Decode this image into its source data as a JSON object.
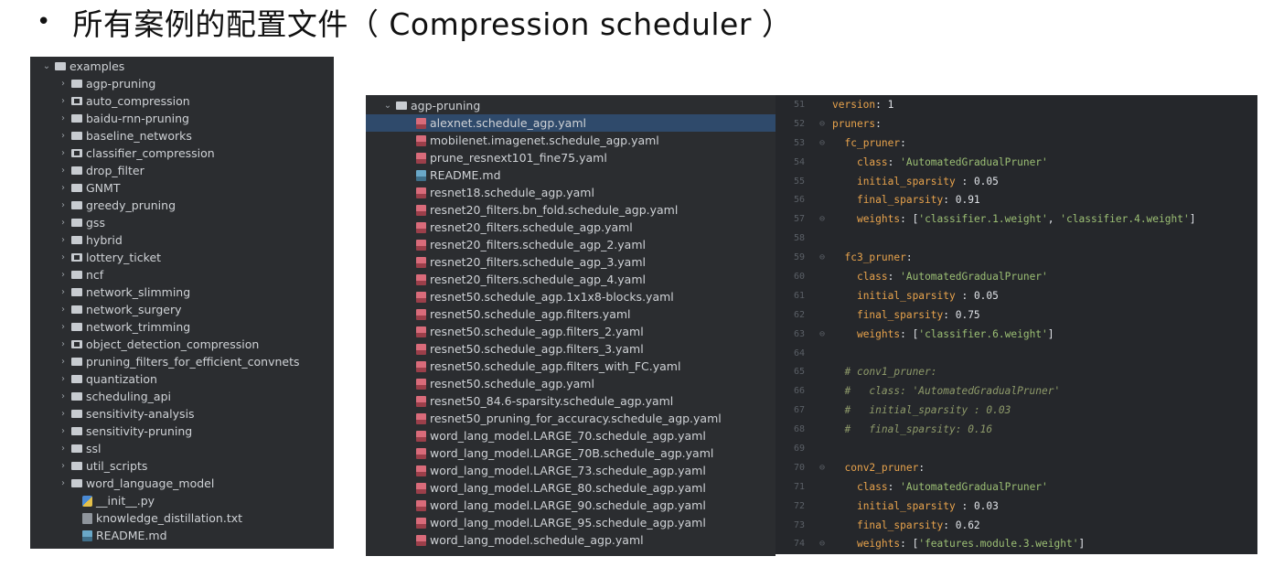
{
  "slide": {
    "bullet": "•",
    "title": "所有案例的配置文件（ Compression scheduler ）"
  },
  "left_tree": {
    "root": "examples",
    "folders": [
      {
        "label": "agp-pruning",
        "mod": false
      },
      {
        "label": "auto_compression",
        "mod": true
      },
      {
        "label": "baidu-rnn-pruning",
        "mod": false
      },
      {
        "label": "baseline_networks",
        "mod": false
      },
      {
        "label": "classifier_compression",
        "mod": true
      },
      {
        "label": "drop_filter",
        "mod": false
      },
      {
        "label": "GNMT",
        "mod": false
      },
      {
        "label": "greedy_pruning",
        "mod": false
      },
      {
        "label": "gss",
        "mod": false
      },
      {
        "label": "hybrid",
        "mod": false
      },
      {
        "label": "lottery_ticket",
        "mod": true
      },
      {
        "label": "ncf",
        "mod": false
      },
      {
        "label": "network_slimming",
        "mod": false
      },
      {
        "label": "network_surgery",
        "mod": false
      },
      {
        "label": "network_trimming",
        "mod": false
      },
      {
        "label": "object_detection_compression",
        "mod": true
      },
      {
        "label": "pruning_filters_for_efficient_convnets",
        "mod": false
      },
      {
        "label": "quantization",
        "mod": false
      },
      {
        "label": "scheduling_api",
        "mod": false
      },
      {
        "label": "sensitivity-analysis",
        "mod": false
      },
      {
        "label": "sensitivity-pruning",
        "mod": false
      },
      {
        "label": "ssl",
        "mod": false
      },
      {
        "label": "util_scripts",
        "mod": false
      },
      {
        "label": "word_language_model",
        "mod": false
      }
    ],
    "files": [
      {
        "label": "__init__.py",
        "icon": "py"
      },
      {
        "label": "knowledge_distillation.txt",
        "icon": "txt"
      },
      {
        "label": "README.md",
        "icon": "md"
      }
    ]
  },
  "right_tree": {
    "root": "agp-pruning",
    "selected": 0,
    "files": [
      {
        "label": "alexnet.schedule_agp.yaml",
        "icon": "yaml"
      },
      {
        "label": "mobilenet.imagenet.schedule_agp.yaml",
        "icon": "yaml"
      },
      {
        "label": "prune_resnext101_fine75.yaml",
        "icon": "yaml"
      },
      {
        "label": "README.md",
        "icon": "md"
      },
      {
        "label": "resnet18.schedule_agp.yaml",
        "icon": "yaml"
      },
      {
        "label": "resnet20_filters.bn_fold.schedule_agp.yaml",
        "icon": "yaml"
      },
      {
        "label": "resnet20_filters.schedule_agp.yaml",
        "icon": "yaml"
      },
      {
        "label": "resnet20_filters.schedule_agp_2.yaml",
        "icon": "yaml"
      },
      {
        "label": "resnet20_filters.schedule_agp_3.yaml",
        "icon": "yaml"
      },
      {
        "label": "resnet20_filters.schedule_agp_4.yaml",
        "icon": "yaml"
      },
      {
        "label": "resnet50.schedule_agp.1x1x8-blocks.yaml",
        "icon": "yaml"
      },
      {
        "label": "resnet50.schedule_agp.filters.yaml",
        "icon": "yaml"
      },
      {
        "label": "resnet50.schedule_agp.filters_2.yaml",
        "icon": "yaml"
      },
      {
        "label": "resnet50.schedule_agp.filters_3.yaml",
        "icon": "yaml"
      },
      {
        "label": "resnet50.schedule_agp.filters_with_FC.yaml",
        "icon": "yaml"
      },
      {
        "label": "resnet50.schedule_agp.yaml",
        "icon": "yaml"
      },
      {
        "label": "resnet50_84.6-sparsity.schedule_agp.yaml",
        "icon": "yaml"
      },
      {
        "label": "resnet50_pruning_for_accuracy.schedule_agp.yaml",
        "icon": "yaml"
      },
      {
        "label": "word_lang_model.LARGE_70.schedule_agp.yaml",
        "icon": "yaml"
      },
      {
        "label": "word_lang_model.LARGE_70B.schedule_agp.yaml",
        "icon": "yaml"
      },
      {
        "label": "word_lang_model.LARGE_73.schedule_agp.yaml",
        "icon": "yaml"
      },
      {
        "label": "word_lang_model.LARGE_80.schedule_agp.yaml",
        "icon": "yaml"
      },
      {
        "label": "word_lang_model.LARGE_90.schedule_agp.yaml",
        "icon": "yaml"
      },
      {
        "label": "word_lang_model.LARGE_95.schedule_agp.yaml",
        "icon": "yaml"
      },
      {
        "label": "word_lang_model.schedule_agp.yaml",
        "icon": "yaml"
      }
    ]
  },
  "editor": {
    "lines": [
      {
        "no": "51",
        "fold": "",
        "parts": [
          [
            "k",
            "version"
          ],
          [
            "n",
            ": 1"
          ]
        ]
      },
      {
        "no": "52",
        "fold": "⊖",
        "parts": [
          [
            "k",
            "pruners"
          ],
          [
            "n",
            ":"
          ]
        ]
      },
      {
        "no": "53",
        "fold": "⊖",
        "parts": [
          [
            "n",
            "  "
          ],
          [
            "k",
            "fc_pruner"
          ],
          [
            "n",
            ":"
          ]
        ]
      },
      {
        "no": "54",
        "fold": "",
        "parts": [
          [
            "n",
            "    "
          ],
          [
            "k",
            "class"
          ],
          [
            "n",
            ": "
          ],
          [
            "s",
            "'AutomatedGradualPruner'"
          ]
        ]
      },
      {
        "no": "55",
        "fold": "",
        "parts": [
          [
            "n",
            "    "
          ],
          [
            "k",
            "initial_sparsity"
          ],
          [
            "n",
            " : 0.05"
          ]
        ]
      },
      {
        "no": "56",
        "fold": "",
        "parts": [
          [
            "n",
            "    "
          ],
          [
            "k",
            "final_sparsity"
          ],
          [
            "n",
            ": 0.91"
          ]
        ]
      },
      {
        "no": "57",
        "fold": "⊖",
        "parts": [
          [
            "n",
            "    "
          ],
          [
            "k",
            "weights"
          ],
          [
            "n",
            ": ["
          ],
          [
            "s",
            "'classifier.1.weight'"
          ],
          [
            "n",
            ", "
          ],
          [
            "s",
            "'classifier.4.weight'"
          ],
          [
            "n",
            "]"
          ]
        ]
      },
      {
        "no": "58",
        "fold": "",
        "parts": []
      },
      {
        "no": "59",
        "fold": "⊖",
        "parts": [
          [
            "n",
            "  "
          ],
          [
            "k",
            "fc3_pruner"
          ],
          [
            "n",
            ":"
          ]
        ]
      },
      {
        "no": "60",
        "fold": "",
        "parts": [
          [
            "n",
            "    "
          ],
          [
            "k",
            "class"
          ],
          [
            "n",
            ": "
          ],
          [
            "s",
            "'AutomatedGradualPruner'"
          ]
        ]
      },
      {
        "no": "61",
        "fold": "",
        "parts": [
          [
            "n",
            "    "
          ],
          [
            "k",
            "initial_sparsity"
          ],
          [
            "n",
            " : 0.05"
          ]
        ]
      },
      {
        "no": "62",
        "fold": "",
        "parts": [
          [
            "n",
            "    "
          ],
          [
            "k",
            "final_sparsity"
          ],
          [
            "n",
            ": 0.75"
          ]
        ]
      },
      {
        "no": "63",
        "fold": "⊖",
        "parts": [
          [
            "n",
            "    "
          ],
          [
            "k",
            "weights"
          ],
          [
            "n",
            ": ["
          ],
          [
            "s",
            "'classifier.6.weight'"
          ],
          [
            "n",
            "]"
          ]
        ]
      },
      {
        "no": "64",
        "fold": "",
        "parts": []
      },
      {
        "no": "65",
        "fold": "",
        "parts": [
          [
            "n",
            "  "
          ],
          [
            "c",
            "# conv1_pruner:"
          ]
        ]
      },
      {
        "no": "66",
        "fold": "",
        "parts": [
          [
            "n",
            "  "
          ],
          [
            "c",
            "#   class: 'AutomatedGradualPruner'"
          ]
        ]
      },
      {
        "no": "67",
        "fold": "",
        "parts": [
          [
            "n",
            "  "
          ],
          [
            "c",
            "#   initial_sparsity : 0.03"
          ]
        ]
      },
      {
        "no": "68",
        "fold": "",
        "parts": [
          [
            "n",
            "  "
          ],
          [
            "c",
            "#   final_sparsity: 0.16"
          ]
        ]
      },
      {
        "no": "69",
        "fold": "",
        "parts": []
      },
      {
        "no": "70",
        "fold": "⊖",
        "parts": [
          [
            "n",
            "  "
          ],
          [
            "k",
            "conv2_pruner"
          ],
          [
            "n",
            ":"
          ]
        ]
      },
      {
        "no": "71",
        "fold": "",
        "parts": [
          [
            "n",
            "    "
          ],
          [
            "k",
            "class"
          ],
          [
            "n",
            ": "
          ],
          [
            "s",
            "'AutomatedGradualPruner'"
          ]
        ]
      },
      {
        "no": "72",
        "fold": "",
        "parts": [
          [
            "n",
            "    "
          ],
          [
            "k",
            "initial_sparsity"
          ],
          [
            "n",
            " : 0.03"
          ]
        ]
      },
      {
        "no": "73",
        "fold": "",
        "parts": [
          [
            "n",
            "    "
          ],
          [
            "k",
            "final_sparsity"
          ],
          [
            "n",
            ": 0.62"
          ]
        ]
      },
      {
        "no": "74",
        "fold": "⊖",
        "parts": [
          [
            "n",
            "    "
          ],
          [
            "k",
            "weights"
          ],
          [
            "n",
            ": ["
          ],
          [
            "s",
            "'features.module.3.weight'"
          ],
          [
            "n",
            "]"
          ]
        ]
      }
    ]
  }
}
